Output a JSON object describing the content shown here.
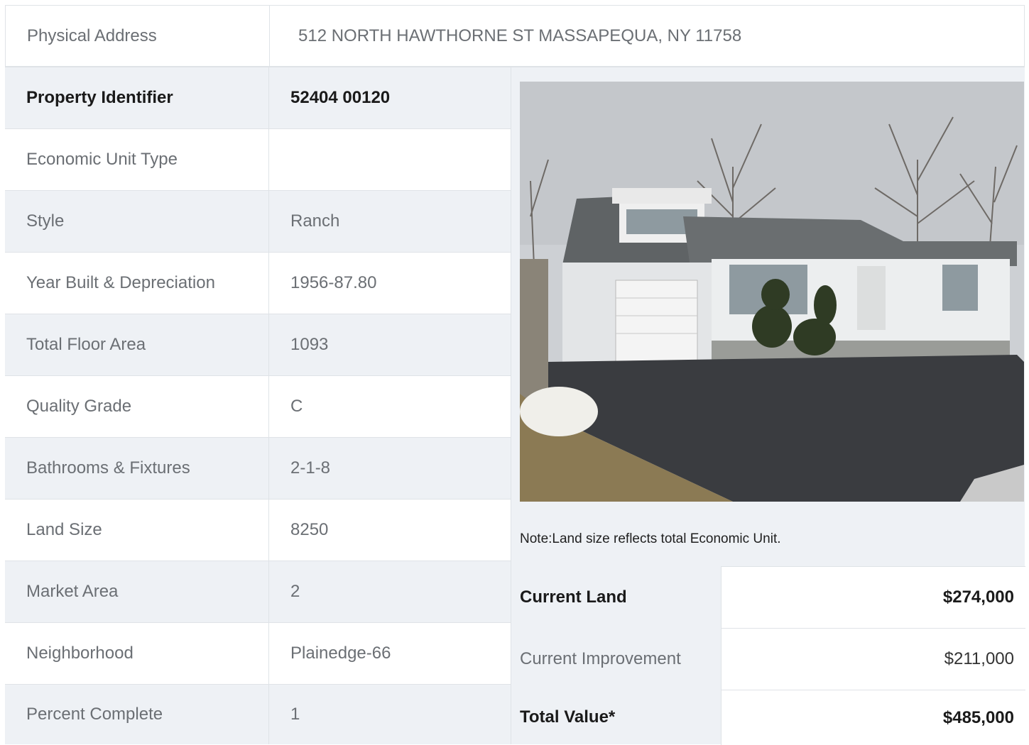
{
  "address": {
    "label": "Physical Address",
    "value": "512  NORTH HAWTHORNE ST  MASSAPEQUA, NY  11758"
  },
  "details": [
    {
      "label": "Property Identifier",
      "value": "52404  00120",
      "bold": true
    },
    {
      "label": "Economic Unit Type",
      "value": ""
    },
    {
      "label": "Style",
      "value": "Ranch"
    },
    {
      "label": "Year Built & Depreciation",
      "value": "1956-87.80"
    },
    {
      "label": "Total Floor Area",
      "value": "1093"
    },
    {
      "label": "Quality Grade",
      "value": "C"
    },
    {
      "label": "Bathrooms & Fixtures",
      "value": "2-1-8"
    },
    {
      "label": "Land Size",
      "value": "8250"
    },
    {
      "label": "Market Area",
      "value": "2"
    },
    {
      "label": "Neighborhood",
      "value": "Plainedge-66"
    },
    {
      "label": "Percent Complete",
      "value": "1"
    }
  ],
  "note": "Note:Land size reflects total Economic Unit.",
  "valuation": [
    {
      "label": "Current Land",
      "value": "$274,000",
      "bold": true
    },
    {
      "label": "Current Improvement",
      "value": "$211,000",
      "bold": false
    },
    {
      "label": "Total Value*",
      "value": "$485,000",
      "bold": true
    }
  ],
  "colors": {
    "row_gray": "#eef1f5",
    "border": "#dfe3e7",
    "text_muted": "#6b6f74",
    "text_bold": "#1a1a1a"
  }
}
